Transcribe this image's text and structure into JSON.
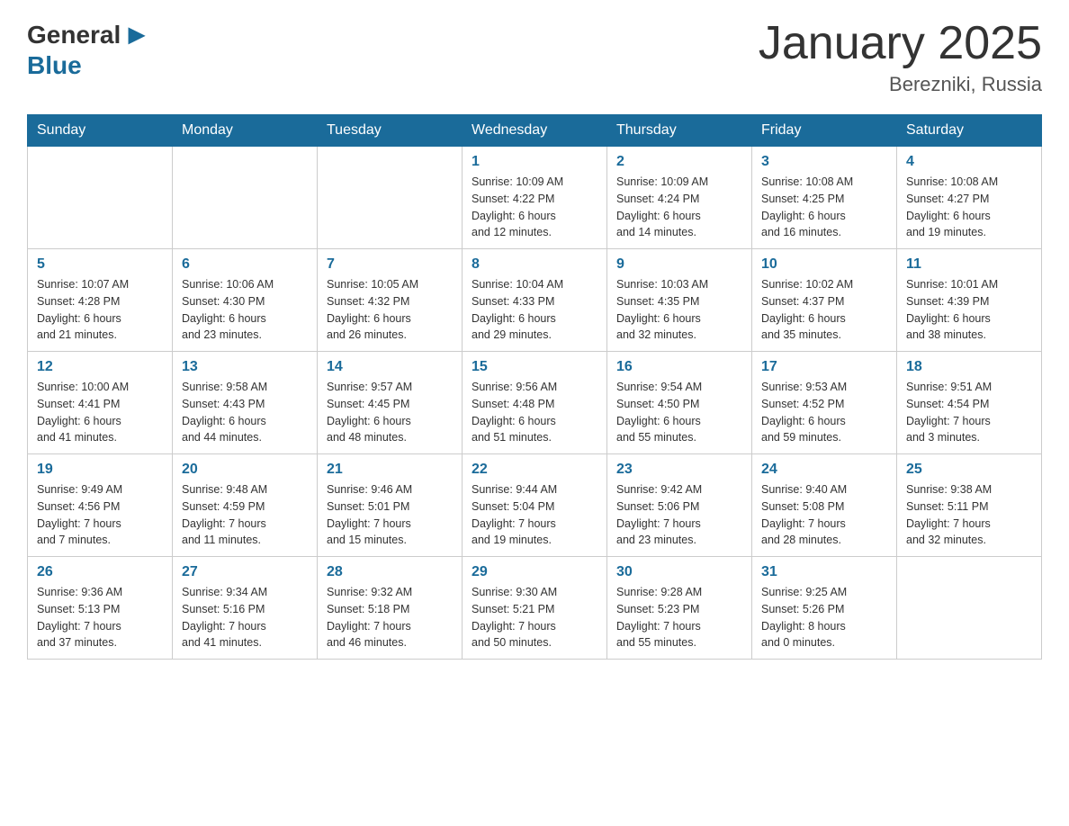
{
  "header": {
    "logo_general": "General",
    "logo_blue": "Blue",
    "month_title": "January 2025",
    "location": "Berezniki, Russia"
  },
  "days_of_week": [
    "Sunday",
    "Monday",
    "Tuesday",
    "Wednesday",
    "Thursday",
    "Friday",
    "Saturday"
  ],
  "weeks": [
    [
      {
        "day": "",
        "info": ""
      },
      {
        "day": "",
        "info": ""
      },
      {
        "day": "",
        "info": ""
      },
      {
        "day": "1",
        "info": "Sunrise: 10:09 AM\nSunset: 4:22 PM\nDaylight: 6 hours\nand 12 minutes."
      },
      {
        "day": "2",
        "info": "Sunrise: 10:09 AM\nSunset: 4:24 PM\nDaylight: 6 hours\nand 14 minutes."
      },
      {
        "day": "3",
        "info": "Sunrise: 10:08 AM\nSunset: 4:25 PM\nDaylight: 6 hours\nand 16 minutes."
      },
      {
        "day": "4",
        "info": "Sunrise: 10:08 AM\nSunset: 4:27 PM\nDaylight: 6 hours\nand 19 minutes."
      }
    ],
    [
      {
        "day": "5",
        "info": "Sunrise: 10:07 AM\nSunset: 4:28 PM\nDaylight: 6 hours\nand 21 minutes."
      },
      {
        "day": "6",
        "info": "Sunrise: 10:06 AM\nSunset: 4:30 PM\nDaylight: 6 hours\nand 23 minutes."
      },
      {
        "day": "7",
        "info": "Sunrise: 10:05 AM\nSunset: 4:32 PM\nDaylight: 6 hours\nand 26 minutes."
      },
      {
        "day": "8",
        "info": "Sunrise: 10:04 AM\nSunset: 4:33 PM\nDaylight: 6 hours\nand 29 minutes."
      },
      {
        "day": "9",
        "info": "Sunrise: 10:03 AM\nSunset: 4:35 PM\nDaylight: 6 hours\nand 32 minutes."
      },
      {
        "day": "10",
        "info": "Sunrise: 10:02 AM\nSunset: 4:37 PM\nDaylight: 6 hours\nand 35 minutes."
      },
      {
        "day": "11",
        "info": "Sunrise: 10:01 AM\nSunset: 4:39 PM\nDaylight: 6 hours\nand 38 minutes."
      }
    ],
    [
      {
        "day": "12",
        "info": "Sunrise: 10:00 AM\nSunset: 4:41 PM\nDaylight: 6 hours\nand 41 minutes."
      },
      {
        "day": "13",
        "info": "Sunrise: 9:58 AM\nSunset: 4:43 PM\nDaylight: 6 hours\nand 44 minutes."
      },
      {
        "day": "14",
        "info": "Sunrise: 9:57 AM\nSunset: 4:45 PM\nDaylight: 6 hours\nand 48 minutes."
      },
      {
        "day": "15",
        "info": "Sunrise: 9:56 AM\nSunset: 4:48 PM\nDaylight: 6 hours\nand 51 minutes."
      },
      {
        "day": "16",
        "info": "Sunrise: 9:54 AM\nSunset: 4:50 PM\nDaylight: 6 hours\nand 55 minutes."
      },
      {
        "day": "17",
        "info": "Sunrise: 9:53 AM\nSunset: 4:52 PM\nDaylight: 6 hours\nand 59 minutes."
      },
      {
        "day": "18",
        "info": "Sunrise: 9:51 AM\nSunset: 4:54 PM\nDaylight: 7 hours\nand 3 minutes."
      }
    ],
    [
      {
        "day": "19",
        "info": "Sunrise: 9:49 AM\nSunset: 4:56 PM\nDaylight: 7 hours\nand 7 minutes."
      },
      {
        "day": "20",
        "info": "Sunrise: 9:48 AM\nSunset: 4:59 PM\nDaylight: 7 hours\nand 11 minutes."
      },
      {
        "day": "21",
        "info": "Sunrise: 9:46 AM\nSunset: 5:01 PM\nDaylight: 7 hours\nand 15 minutes."
      },
      {
        "day": "22",
        "info": "Sunrise: 9:44 AM\nSunset: 5:04 PM\nDaylight: 7 hours\nand 19 minutes."
      },
      {
        "day": "23",
        "info": "Sunrise: 9:42 AM\nSunset: 5:06 PM\nDaylight: 7 hours\nand 23 minutes."
      },
      {
        "day": "24",
        "info": "Sunrise: 9:40 AM\nSunset: 5:08 PM\nDaylight: 7 hours\nand 28 minutes."
      },
      {
        "day": "25",
        "info": "Sunrise: 9:38 AM\nSunset: 5:11 PM\nDaylight: 7 hours\nand 32 minutes."
      }
    ],
    [
      {
        "day": "26",
        "info": "Sunrise: 9:36 AM\nSunset: 5:13 PM\nDaylight: 7 hours\nand 37 minutes."
      },
      {
        "day": "27",
        "info": "Sunrise: 9:34 AM\nSunset: 5:16 PM\nDaylight: 7 hours\nand 41 minutes."
      },
      {
        "day": "28",
        "info": "Sunrise: 9:32 AM\nSunset: 5:18 PM\nDaylight: 7 hours\nand 46 minutes."
      },
      {
        "day": "29",
        "info": "Sunrise: 9:30 AM\nSunset: 5:21 PM\nDaylight: 7 hours\nand 50 minutes."
      },
      {
        "day": "30",
        "info": "Sunrise: 9:28 AM\nSunset: 5:23 PM\nDaylight: 7 hours\nand 55 minutes."
      },
      {
        "day": "31",
        "info": "Sunrise: 9:25 AM\nSunset: 5:26 PM\nDaylight: 8 hours\nand 0 minutes."
      },
      {
        "day": "",
        "info": ""
      }
    ]
  ]
}
